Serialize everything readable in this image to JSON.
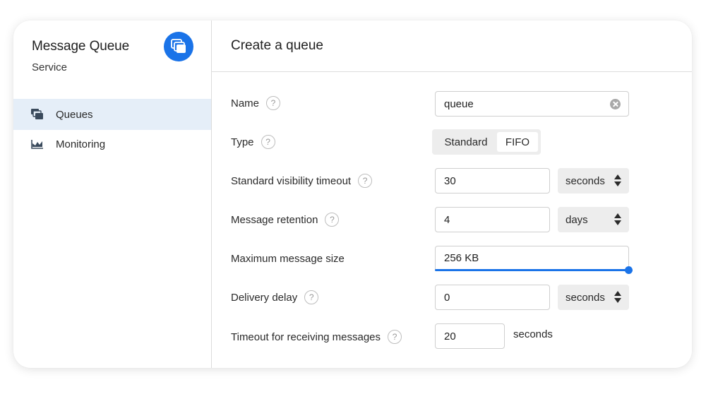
{
  "sidebar": {
    "service_title": "Message Queue",
    "service_subtitle": "Service",
    "logo_icon": "stacked-windows-icon",
    "items": [
      {
        "label": "Queues",
        "icon": "queues-icon",
        "active": true
      },
      {
        "label": "Monitoring",
        "icon": "chart-icon",
        "active": false
      }
    ]
  },
  "main": {
    "title": "Create a queue",
    "help_glyph": "?",
    "fields": {
      "name": {
        "label": "Name",
        "value": "queue"
      },
      "type": {
        "label": "Type",
        "options": [
          "Standard",
          "FIFO"
        ],
        "selected": "FIFO"
      },
      "visibility_timeout": {
        "label": "Standard visibility timeout",
        "value": "30",
        "unit": "seconds"
      },
      "retention": {
        "label": "Message retention",
        "value": "4",
        "unit": "days"
      },
      "max_size": {
        "label": "Maximum message size",
        "value": "256 KB",
        "slider_fraction": 1.0
      },
      "delivery_delay": {
        "label": "Delivery delay",
        "value": "0",
        "unit": "seconds"
      },
      "receive_timeout": {
        "label": "Timeout for receiving messages",
        "value": "20",
        "unit": "seconds"
      }
    }
  },
  "colors": {
    "accent": "#1a73e8",
    "active_nav_bg": "#e5eef8",
    "control_bg": "#ededed"
  }
}
